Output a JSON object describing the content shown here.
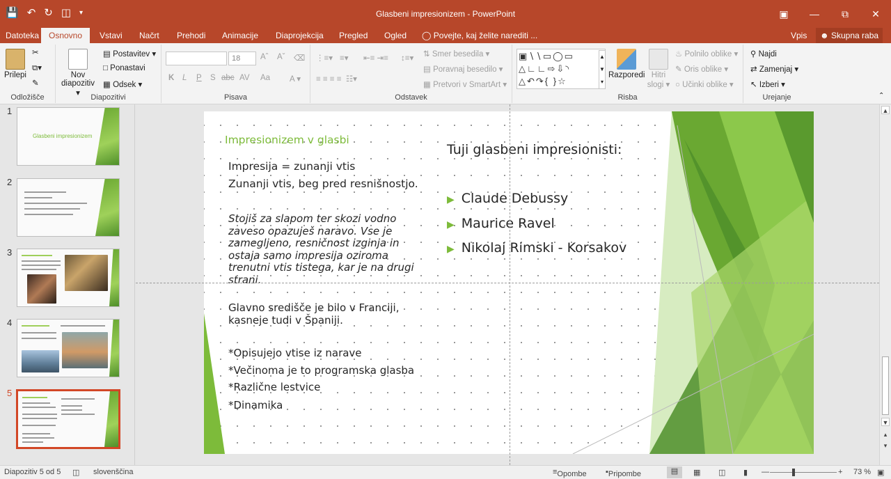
{
  "window": {
    "title": "Glasbeni impresionizem - PowerPoint",
    "colors": {
      "accent": "#b7472a",
      "slide_green": "#7dbb3a",
      "active_thumb_border": "#d24726"
    }
  },
  "tabs": {
    "file": "Datoteka",
    "home": "Osnovno",
    "insert": "Vstavi",
    "design": "Načrt",
    "transitions": "Prehodi",
    "animations": "Animacije",
    "slideshow": "Diaprojekcija",
    "review": "Pregled",
    "view": "Ogled",
    "tell_me": "Povejte, kaj želite narediti ...",
    "signin": "Vpis",
    "share": "Skupna raba"
  },
  "ribbon": {
    "clipboard": {
      "label": "Odložišče",
      "paste": "Prilepi"
    },
    "slides": {
      "label": "Diapozitivi",
      "new_slide_1": "Nov",
      "new_slide_2": "diapozitiv",
      "layout": "Postavitev",
      "reset": "Ponastavi",
      "section": "Odsek"
    },
    "font": {
      "label": "Pisava",
      "size": "18",
      "bold": "K",
      "italic": "L",
      "underline": "P",
      "strike": "S",
      "shadow": "abc",
      "spacing": "AV",
      "case": "Aa"
    },
    "paragraph": {
      "label": "Odstavek",
      "text_direction": "Smer besedila",
      "align_text": "Poravnaj besedilo",
      "smartart": "Pretvori v SmartArt"
    },
    "drawing": {
      "label": "Risba",
      "arrange": "Razporedi",
      "quick_styles_1": "Hitri",
      "quick_styles_2": "slogi",
      "fill": "Polnilo oblike",
      "outline": "Oris oblike",
      "effects": "Učinki oblike"
    },
    "editing": {
      "label": "Urejanje",
      "find": "Najdi",
      "replace": "Zamenjaj",
      "select": "Izberi"
    }
  },
  "thumbnails": [
    {
      "number": "1",
      "title": "Glasbeni impresionizem"
    },
    {
      "number": "2"
    },
    {
      "number": "3"
    },
    {
      "number": "4"
    },
    {
      "number": "5"
    }
  ],
  "slide": {
    "title": "Impresionizem v glasbi",
    "left_lines": [
      "Impresija = zunanji vtis",
      "Zunanji vtis, beg pred resnišnostjo."
    ],
    "italic_paragraph": [
      "Stojiš za slapom ter skozi vodno",
      "zaveso opazuješ naravo. Vse je",
      "zamegljeno, resničnost izginja in",
      "ostaja samo impresija oziroma",
      "trenutni vtis tistega, kar je na drugi",
      "strani."
    ],
    "center_lines": [
      "Glavno središče je bilo v Franciji,",
      "kasneje tudi v Španiji."
    ],
    "features": [
      "*Opisujejo vtise iz narave",
      "*Večinoma je to programska glasba",
      "*Različne lestvice",
      "*Dinamika"
    ],
    "right_title": "Tuji glasbeni impresionisti:",
    "composers": [
      "Claude Debussy",
      "Maurice Ravel",
      "Nikolaj Rimski - Korsakov"
    ]
  },
  "status": {
    "slide_count": "Diapozitiv 5 od 5",
    "language": "slovenščina",
    "notes": "Opombe",
    "comments": "Pripombe",
    "zoom_percent": "73 %",
    "zoom_level": 0.73
  }
}
